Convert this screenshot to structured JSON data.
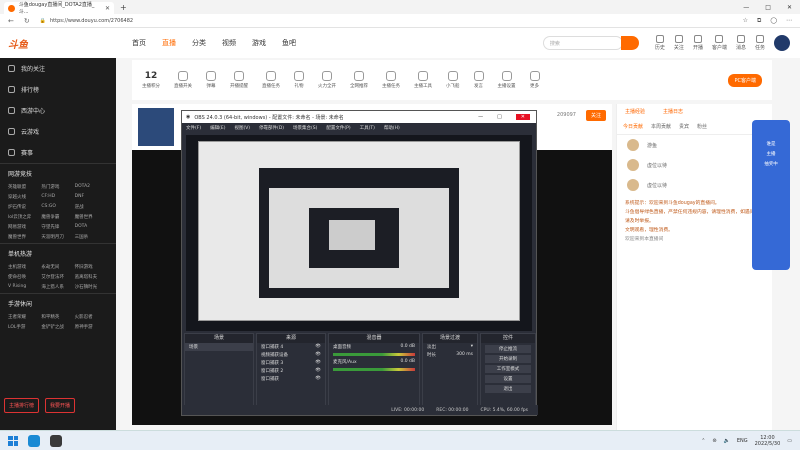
{
  "browser": {
    "tab_title": "斗鱼dougay直播间_DOTA2直播_斗...",
    "url": "https://www.douyu.com/2706482",
    "window_controls": [
      "—",
      "□",
      "✕"
    ]
  },
  "site": {
    "logo": "斗鱼",
    "sidebar": {
      "items": [
        "我的关注",
        "排行榜",
        "西游中心",
        "云游戏",
        "赛事"
      ],
      "section_games": "网游竞技",
      "games": [
        "英雄联盟",
        "热门游戏",
        "DOTA2",
        "穿越火线",
        "CF:HD",
        "DNF",
        "炉石传说",
        "CS:GO",
        "逆战",
        "lol云顶之弈",
        "魔兽争霸",
        "魔兽世界",
        "网易游戏",
        "守望先锋",
        "DOTA",
        "魔兽世界",
        "天涯明月刀",
        "三国杀"
      ],
      "section_mobile": "单机热游",
      "mobile": [
        "主机游戏",
        "永劫无间",
        "怀旧游戏",
        "使命召唤",
        "艾尔登法环",
        "逃离塔科夫",
        "V Rising",
        "海上猎人系",
        "沙石镇时光"
      ],
      "section_other": "手游休闲",
      "other": [
        "王者荣耀",
        "和平精英",
        "火影忍者",
        "LOL手游",
        "金铲铲之战",
        "原神手游"
      ],
      "btn_rank": "主播排行榜",
      "btn_start": "我要开播"
    },
    "topnav": [
      "首页",
      "直播",
      "分类",
      "视频",
      "游戏",
      "鱼吧"
    ],
    "topnav_active": "直播",
    "search_placeholder": "搜索",
    "topicons": [
      "历史",
      "关注",
      "开播",
      "客户端",
      "消息",
      "任务"
    ],
    "toolrow": [
      {
        "label": "主播积分",
        "value": "12"
      },
      {
        "label": "直播开关"
      },
      {
        "label": "弹幕"
      },
      {
        "label": "开播提醒"
      },
      {
        "label": "直播任务"
      },
      {
        "label": "礼物"
      },
      {
        "label": "火力全开"
      },
      {
        "label": "全网推荐"
      },
      {
        "label": "主播任务"
      },
      {
        "label": "主播工具"
      },
      {
        "label": "小飞船"
      },
      {
        "label": "发言"
      },
      {
        "label": "主播设置"
      },
      {
        "label": "更多"
      }
    ],
    "pc_button": "PC客户端",
    "stream": {
      "follow_count": "209097",
      "follow_btn": "关注",
      "badge_text": "鱼吧 ▸"
    },
    "chat": {
      "tabs": [
        "今日贡献",
        "本周贡献",
        "贵宾",
        "粉丝"
      ],
      "top": [
        "主播经验",
        "主播日志"
      ],
      "ranks": [
        "游鱼",
        "虚位以待",
        "虚位以待"
      ],
      "messages": [
        "系统提示：欢迎来到斗鱼dougay的直播间。",
        "斗鱼倡导绿色直播，严禁任何违规内容，请理性消费，如遇问题请及时举报。",
        "文明观看，理性消费。",
        "欢迎来到本直播间"
      ]
    }
  },
  "obs": {
    "title": "OBS 24.0.3 (64-bit, windows) - 配置文件: 未命名 - 场景: 未命名",
    "menu": [
      "文件(F)",
      "编辑(E)",
      "视图(V)",
      "停靠部件(D)",
      "场景集合(S)",
      "配置文件(P)",
      "工具(T)",
      "帮助(H)"
    ],
    "docks": {
      "scenes_title": "场景",
      "scene": "场景",
      "sources_title": "来源",
      "sources": [
        "窗口捕获 4",
        "视频捕获设备",
        "窗口捕获 3",
        "窗口捕获 2",
        "窗口捕获"
      ],
      "mixer_title": "混音器",
      "mixer": [
        "桌面音频",
        "麦克风/Aux"
      ],
      "mixer_db": [
        "0.0 dB",
        "0.0 dB"
      ],
      "transitions_title": "场景过渡",
      "transition": "淡出",
      "duration_label": "时长",
      "duration": "300 ms",
      "controls_title": "控件",
      "controls": [
        "停止推流",
        "开始录制",
        "工作室模式",
        "设置",
        "退出"
      ]
    },
    "status": [
      "LIVE: 00:00:00",
      "REC: 00:00:00",
      "CPU: 5.4%, 60.00 fps"
    ]
  },
  "taskbar": {
    "time": "12:00",
    "date": "2022/5/30",
    "lang": "ENG"
  },
  "right_float": [
    "谁是",
    "主播",
    "抽奖中"
  ]
}
